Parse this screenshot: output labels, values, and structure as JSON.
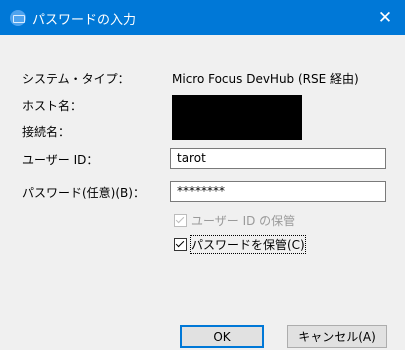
{
  "dialog": {
    "title": "パスワードの入力",
    "close_glyph": "✕",
    "system_type_label": "システム・タイプ：",
    "system_type_value": "Micro Focus DevHub (RSE 経由)",
    "host_label": "ホスト名：",
    "connection_label": "接続名：",
    "user_id_label": "ユーザー ID：",
    "user_id_value": "tarot",
    "password_label": "パスワード(任意)(B)：",
    "password_value": "********",
    "save_user_id_label": "ユーザー ID の保管",
    "save_user_id_checked": true,
    "save_user_id_disabled": true,
    "save_password_label": "パスワードを保管(C)",
    "save_password_checked": true,
    "ok_label": "OK",
    "cancel_label": "キャンセル(A)"
  },
  "colors": {
    "titlebar": "#0078d7",
    "window_bg": "#f0f0f0",
    "default_button_border": "#0078d7"
  }
}
